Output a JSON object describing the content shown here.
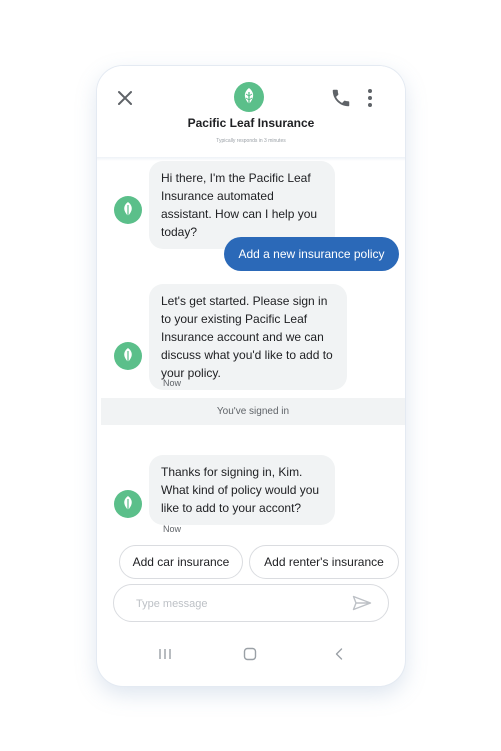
{
  "header": {
    "title": "Pacific Leaf Insurance",
    "subtitle": "Typically responds in 3 minutes"
  },
  "messages": [
    {
      "from": "bot",
      "text": "Hi there, I'm the Pacific Leaf Insurance automated assistant. How can I help you today?"
    },
    {
      "from": "user",
      "text": "Add a new insurance policy"
    },
    {
      "from": "bot",
      "text": "Let's get started. Please sign in to your existing Pacific Leaf Insurance account and we can discuss what you'd like to add to your policy.",
      "time": "Now"
    },
    {
      "from": "system",
      "text": "You've signed in"
    },
    {
      "from": "bot",
      "text": "Thanks for signing in, Kim. What kind of policy would you like to add to your accont?",
      "time": "Now"
    }
  ],
  "suggestions": [
    "Add car insurance",
    "Add renter's insurance"
  ],
  "composer": {
    "placeholder": "Type message"
  },
  "colors": {
    "brand_green": "#5bbf8a",
    "user_bubble": "#2b69b8",
    "bot_bubble": "#f1f3f4"
  },
  "icons": [
    "close-icon",
    "phone-icon",
    "more-vert-icon",
    "leaf-logo-icon",
    "send-icon",
    "nav-recents-icon",
    "nav-home-icon",
    "nav-back-icon"
  ]
}
